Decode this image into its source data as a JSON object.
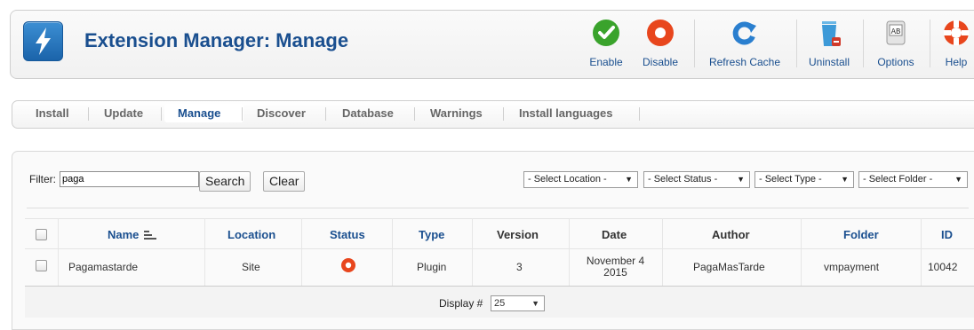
{
  "header": {
    "title": "Extension Manager: Manage",
    "toolbar": [
      {
        "label": "Enable",
        "icon": "enable-icon"
      },
      {
        "label": "Disable",
        "icon": "disable-icon"
      },
      {
        "label": "Refresh Cache",
        "icon": "refresh-icon"
      },
      {
        "label": "Uninstall",
        "icon": "trash-icon"
      },
      {
        "label": "Options",
        "icon": "options-icon",
        "icon_text": "AB"
      },
      {
        "label": "Help",
        "icon": "help-icon"
      }
    ]
  },
  "submenu": {
    "items": [
      "Install",
      "Update",
      "Manage",
      "Discover",
      "Database",
      "Warnings",
      "Install languages"
    ],
    "active": "Manage"
  },
  "filter": {
    "label": "Filter:",
    "value": "paga",
    "search_label": "Search",
    "clear_label": "Clear",
    "selects": [
      "- Select Location -",
      "- Select Status -",
      "- Select Type -",
      "- Select Folder -"
    ]
  },
  "table": {
    "columns": [
      "Name",
      "Location",
      "Status",
      "Type",
      "Version",
      "Date",
      "Author",
      "Folder",
      "ID"
    ],
    "rows": [
      {
        "name": "Pagamastarde",
        "location": "Site",
        "status": "disabled",
        "type": "Plugin",
        "version": "3",
        "date_line1": "November 4",
        "date_line2": "2015",
        "author": "PagaMasTarde",
        "folder": "vmpayment",
        "id": "10042"
      }
    ],
    "display_label": "Display #",
    "display_value": "25"
  },
  "colors": {
    "accent": "#1a4f8f",
    "enable": "#3aa32c",
    "disable": "#e8461d",
    "refresh": "#2a7fcf"
  }
}
